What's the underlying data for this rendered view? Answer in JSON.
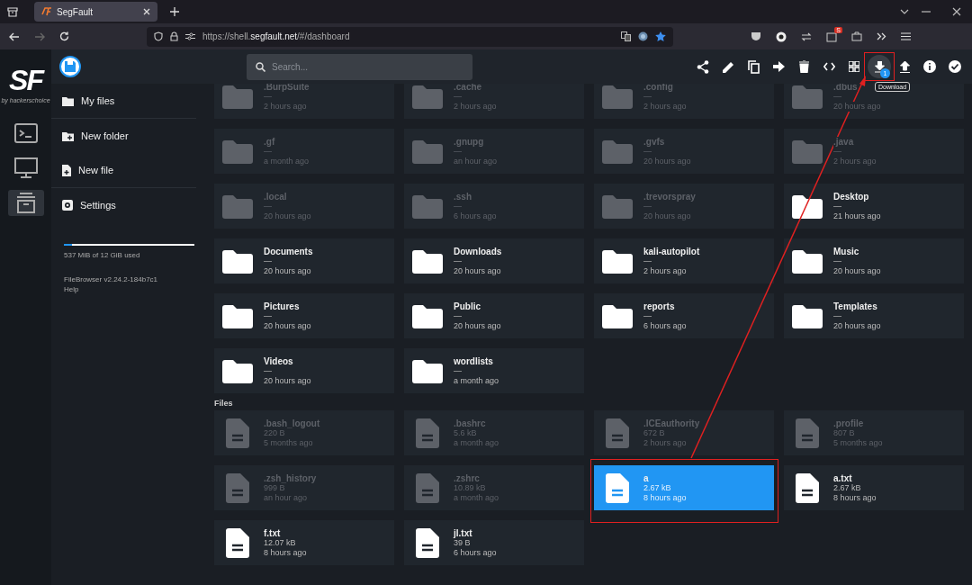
{
  "browser": {
    "tab": {
      "title": "SegFault",
      "selected": true
    },
    "url": {
      "start": "https://shell.",
      "domain": "segfault.net",
      "path": "/#/dashboard"
    },
    "extension_badge": "S",
    "forward_disabled": true
  },
  "rail": {
    "logo": "SF",
    "tagline": "by hackerschoice",
    "items": [
      {
        "kind": "terminal",
        "selected": false
      },
      {
        "kind": "monitor",
        "selected": false
      },
      {
        "kind": "archive",
        "selected": true
      }
    ]
  },
  "search": {
    "placeholder": "Search..."
  },
  "tools": [
    {
      "kind": "share",
      "active": false
    },
    {
      "kind": "edit",
      "active": false
    },
    {
      "kind": "copy",
      "active": false
    },
    {
      "kind": "move",
      "active": false
    },
    {
      "kind": "delete",
      "active": false
    },
    {
      "kind": "code",
      "active": false
    },
    {
      "kind": "grid",
      "active": false
    },
    {
      "kind": "download",
      "active": true,
      "highlighted": true,
      "badge": "1",
      "tooltip": "Download"
    },
    {
      "kind": "upload",
      "active": false
    },
    {
      "kind": "info",
      "active": false
    },
    {
      "kind": "check",
      "active": false
    }
  ],
  "nav": [
    {
      "kind": "folder",
      "label": "My files",
      "divider_after": true
    },
    {
      "kind": "new-folder",
      "label": "New folder",
      "divider_after": false
    },
    {
      "kind": "new-file",
      "label": "New file",
      "divider_after": true
    },
    {
      "kind": "settings",
      "label": "Settings",
      "divider_after": false
    }
  ],
  "storage": {
    "level": 0.06,
    "text": "537 MiB of 12 GiB used"
  },
  "version": "FileBrowser v2.24.2-184b7c1",
  "help": "Help",
  "folders": [
    {
      "name": ".BurpSuite",
      "size": "—",
      "modified": "2 hours ago",
      "hidden": true,
      "selected": false
    },
    {
      "name": ".cache",
      "size": "—",
      "modified": "2 hours ago",
      "hidden": true,
      "selected": false
    },
    {
      "name": ".config",
      "size": "—",
      "modified": "2 hours ago",
      "hidden": true,
      "selected": false
    },
    {
      "name": ".dbus",
      "size": "—",
      "modified": "20 hours ago",
      "hidden": true,
      "selected": false
    },
    {
      "name": ".gf",
      "size": "—",
      "modified": "a month ago",
      "hidden": true,
      "selected": false
    },
    {
      "name": ".gnupg",
      "size": "—",
      "modified": "an hour ago",
      "hidden": true,
      "selected": false
    },
    {
      "name": ".gvfs",
      "size": "—",
      "modified": "20 hours ago",
      "hidden": true,
      "selected": false
    },
    {
      "name": ".java",
      "size": "—",
      "modified": "2 hours ago",
      "hidden": true,
      "selected": false
    },
    {
      "name": ".local",
      "size": "—",
      "modified": "20 hours ago",
      "hidden": true,
      "selected": false
    },
    {
      "name": ".ssh",
      "size": "—",
      "modified": "6 hours ago",
      "hidden": true,
      "selected": false
    },
    {
      "name": ".trevorspray",
      "size": "—",
      "modified": "20 hours ago",
      "hidden": true,
      "selected": false
    },
    {
      "name": "Desktop",
      "size": "—",
      "modified": "21 hours ago",
      "hidden": false,
      "selected": false
    },
    {
      "name": "Documents",
      "size": "—",
      "modified": "20 hours ago",
      "hidden": false,
      "selected": false
    },
    {
      "name": "Downloads",
      "size": "—",
      "modified": "20 hours ago",
      "hidden": false,
      "selected": false
    },
    {
      "name": "kali-autopilot",
      "size": "—",
      "modified": "2 hours ago",
      "hidden": false,
      "selected": false
    },
    {
      "name": "Music",
      "size": "—",
      "modified": "20 hours ago",
      "hidden": false,
      "selected": false
    },
    {
      "name": "Pictures",
      "size": "—",
      "modified": "20 hours ago",
      "hidden": false,
      "selected": false
    },
    {
      "name": "Public",
      "size": "—",
      "modified": "20 hours ago",
      "hidden": false,
      "selected": false
    },
    {
      "name": "reports",
      "size": "—",
      "modified": "6 hours ago",
      "hidden": false,
      "selected": false
    },
    {
      "name": "Templates",
      "size": "—",
      "modified": "20 hours ago",
      "hidden": false,
      "selected": false
    },
    {
      "name": "Videos",
      "size": "—",
      "modified": "20 hours ago",
      "hidden": false,
      "selected": false
    },
    {
      "name": "wordlists",
      "size": "—",
      "modified": "a month ago",
      "hidden": false,
      "selected": false
    }
  ],
  "files_heading": "Files",
  "files": [
    {
      "name": ".bash_logout",
      "size": "220 B",
      "modified": "5 months ago",
      "hidden": true,
      "selected": false,
      "highlighted": false
    },
    {
      "name": ".bashrc",
      "size": "5.6 kB",
      "modified": "a month ago",
      "hidden": true,
      "selected": false,
      "highlighted": false
    },
    {
      "name": ".ICEauthority",
      "size": "672 B",
      "modified": "2 hours ago",
      "hidden": true,
      "selected": false,
      "highlighted": false
    },
    {
      "name": ".profile",
      "size": "807 B",
      "modified": "5 months ago",
      "hidden": true,
      "selected": false,
      "highlighted": false
    },
    {
      "name": ".zsh_history",
      "size": "999 B",
      "modified": "an hour ago",
      "hidden": true,
      "selected": false,
      "highlighted": false
    },
    {
      "name": ".zshrc",
      "size": "10.89 kB",
      "modified": "a month ago",
      "hidden": true,
      "selected": false,
      "highlighted": false
    },
    {
      "name": "a",
      "size": "2.67 kB",
      "modified": "8 hours ago",
      "hidden": false,
      "selected": true,
      "highlighted": true
    },
    {
      "name": "a.txt",
      "size": "2.67 kB",
      "modified": "8 hours ago",
      "hidden": false,
      "selected": false,
      "highlighted": false
    },
    {
      "name": "f.txt",
      "size": "12.07 kB",
      "modified": "8 hours ago",
      "hidden": false,
      "selected": false,
      "highlighted": false
    },
    {
      "name": "jl.txt",
      "size": "39 B",
      "modified": "6 hours ago",
      "hidden": false,
      "selected": false,
      "highlighted": false
    }
  ]
}
